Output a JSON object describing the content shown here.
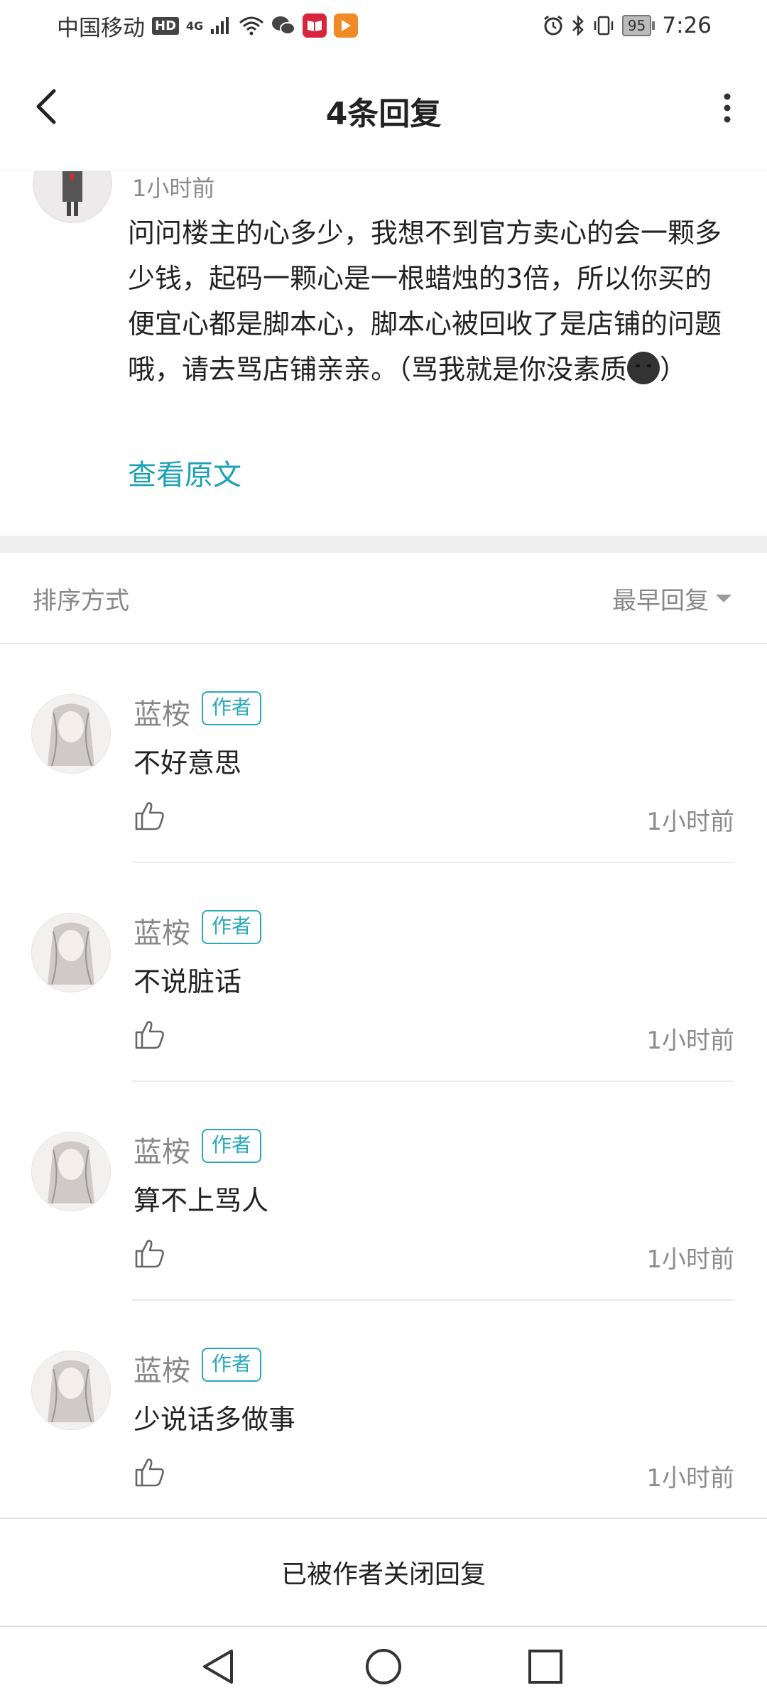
{
  "status_bar": {
    "carrier": "中国移动",
    "hd_label": "HD",
    "network_label": "4G",
    "battery_level": "95",
    "time": "7:26"
  },
  "header": {
    "title": "4条回复"
  },
  "original_comment": {
    "time": "1小时前",
    "text": "问问楼主的心多少，我想不到官方卖心的会一颗多少钱，起码一颗心是一根蜡烛的3倍，所以你买的便宜心都是脚本心，脚本心被回收了是店铺的问题哦，请去骂店铺亲亲。（骂我就是你没素质",
    "text_end": "）",
    "view_original_label": "查看原文"
  },
  "sort": {
    "label": "排序方式",
    "selected": "最早回复"
  },
  "replies": [
    {
      "name": "蓝桉",
      "badge": "作者",
      "text": "不好意思",
      "time": "1小时前"
    },
    {
      "name": "蓝桉",
      "badge": "作者",
      "text": "不说脏话",
      "time": "1小时前"
    },
    {
      "name": "蓝桉",
      "badge": "作者",
      "text": "算不上骂人",
      "time": "1小时前"
    },
    {
      "name": "蓝桉",
      "badge": "作者",
      "text": "少说话多做事",
      "time": "1小时前"
    }
  ],
  "footer": {
    "closed_text": "已被作者关闭回复"
  },
  "colors": {
    "accent": "#1aa2b4",
    "badge": "#2aa9bd",
    "divider_band": "#eeeeee"
  }
}
